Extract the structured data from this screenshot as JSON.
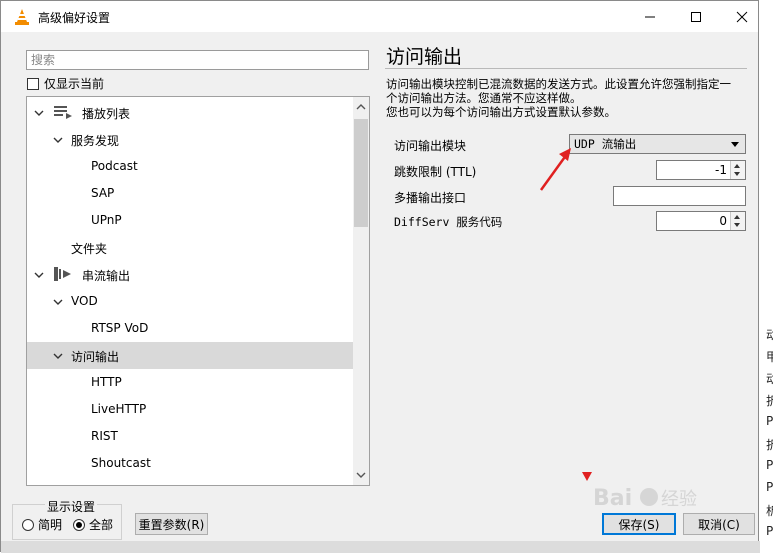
{
  "window": {
    "title": "高级偏好设置",
    "icon": "vlc-cone-icon"
  },
  "left": {
    "search_placeholder": "搜索",
    "only_show_current": "仅显示当前",
    "tree": [
      {
        "label": "播放列表",
        "level": 0,
        "expanded": true,
        "icon": "playlist-icon"
      },
      {
        "label": "服务发现",
        "level": 1,
        "expanded": true
      },
      {
        "label": "Podcast",
        "level": 2
      },
      {
        "label": "SAP",
        "level": 2
      },
      {
        "label": "UPnP",
        "level": 2
      },
      {
        "label": "文件夹",
        "level": 1
      },
      {
        "label": "串流输出",
        "level": 0,
        "expanded": true,
        "icon": "stream-output-icon"
      },
      {
        "label": "VOD",
        "level": 1,
        "expanded": true
      },
      {
        "label": "RTSP VoD",
        "level": 2
      },
      {
        "label": "访问输出",
        "level": 1,
        "expanded": true,
        "selected": true
      },
      {
        "label": "HTTP",
        "level": 2
      },
      {
        "label": "LiveHTTP",
        "level": 2
      },
      {
        "label": "RIST",
        "level": 2
      },
      {
        "label": "Shoutcast",
        "level": 2
      }
    ]
  },
  "right": {
    "title": "访问输出",
    "description_lines": [
      "访问输出模块控制已混流数据的发送方式。此设置允许您强制指定一",
      "个访问输出方法。您通常不应这样做。",
      "您也可以为每个访问输出方式设置默认参数。"
    ],
    "module_label": "访问输出模块",
    "module_value": "UDP 流输出",
    "ttl_label": "跳数限制 (TTL)",
    "ttl_value": "-1",
    "multicast_label": "多播输出接口",
    "multicast_value": "",
    "diffserv_label": "DiffServ 服务代码",
    "diffserv_value": "0"
  },
  "bottom": {
    "show_settings_label": "显示设置",
    "simple_label": "简明",
    "all_label": "全部",
    "all_selected": true,
    "reset_label": "重置参数(R)",
    "save_label": "保存(S)",
    "cancel_label": "取消(C)"
  },
  "background_right_fragments": [
    "寄",
    "动",
    "甲",
    "动",
    "折",
    "P",
    "折",
    "P",
    "P",
    "析",
    "P",
    "动"
  ],
  "colors": {
    "accent": "#0078d7",
    "annotation_arrow": "#e02020",
    "selected_row": "#d9d9d9",
    "vlc_orange": "#f28c00"
  }
}
